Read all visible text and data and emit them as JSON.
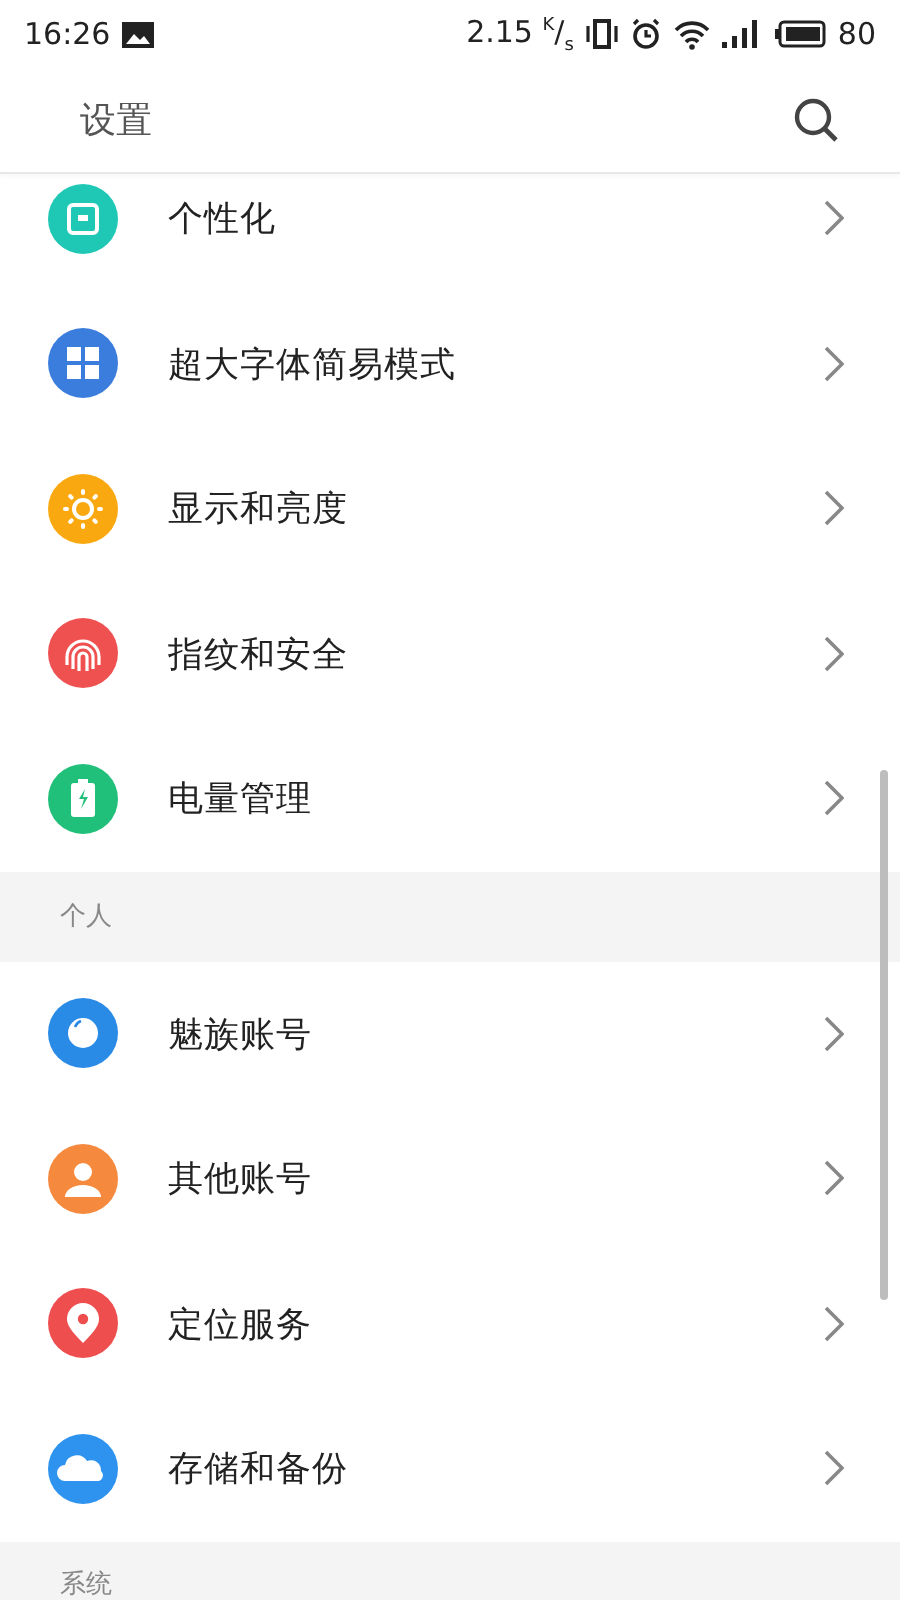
{
  "status_bar": {
    "time": "16:26",
    "speed": "2.15 $^{K}$/$_{s}$",
    "battery": "80"
  },
  "header": {
    "title": "设置"
  },
  "sections": [
    {
      "items": [
        {
          "label": "个性化",
          "kind": "theme",
          "color": "#1fc8b4"
        },
        {
          "label": "超大字体简易模式",
          "kind": "grid",
          "color": "#3b7ddd"
        },
        {
          "label": "显示和亮度",
          "kind": "sun",
          "color": "#f9a90f"
        },
        {
          "label": "指纹和安全",
          "kind": "fingerprint",
          "color": "#ef5050"
        },
        {
          "label": "电量管理",
          "kind": "battery",
          "color": "#20c07a"
        }
      ]
    },
    {
      "title": "个人",
      "items": [
        {
          "label": "魅族账号",
          "kind": "ring",
          "color": "#2a8be6"
        },
        {
          "label": "其他账号",
          "kind": "person",
          "color": "#f5893e"
        },
        {
          "label": "定位服务",
          "kind": "pin",
          "color": "#ef4e4e"
        },
        {
          "label": "存储和备份",
          "kind": "cloud",
          "color": "#2d93ee"
        }
      ]
    },
    {
      "title": "系统"
    }
  ]
}
